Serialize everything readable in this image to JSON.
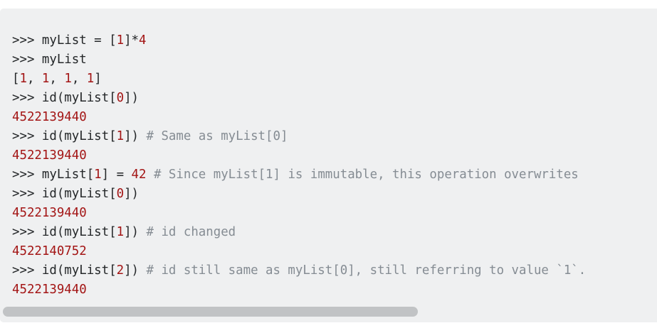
{
  "code": {
    "lines": [
      [
        {
          "t": ">>> myList = ["
        },
        {
          "t": "1",
          "c": "num"
        },
        {
          "t": "]*"
        },
        {
          "t": "4",
          "c": "num"
        }
      ],
      [
        {
          "t": ">>> myList"
        }
      ],
      [
        {
          "t": "["
        },
        {
          "t": "1",
          "c": "num"
        },
        {
          "t": ", "
        },
        {
          "t": "1",
          "c": "num"
        },
        {
          "t": ", "
        },
        {
          "t": "1",
          "c": "num"
        },
        {
          "t": ", "
        },
        {
          "t": "1",
          "c": "num"
        },
        {
          "t": "]"
        }
      ],
      [
        {
          "t": ">>> id(myList["
        },
        {
          "t": "0",
          "c": "num"
        },
        {
          "t": "])"
        }
      ],
      [
        {
          "t": "4522139440",
          "c": "out"
        }
      ],
      [
        {
          "t": ">>> id(myList["
        },
        {
          "t": "1",
          "c": "num"
        },
        {
          "t": "]) "
        },
        {
          "t": "# Same as myList[0]",
          "c": "cmt"
        }
      ],
      [
        {
          "t": "4522139440",
          "c": "out"
        }
      ],
      [
        {
          "t": ">>> myList["
        },
        {
          "t": "1",
          "c": "num"
        },
        {
          "t": "] = "
        },
        {
          "t": "42",
          "c": "num"
        },
        {
          "t": " "
        },
        {
          "t": "# Since myList[1] is immutable, this operation overwrites",
          "c": "cmt"
        }
      ],
      [
        {
          "t": ">>> id(myList["
        },
        {
          "t": "0",
          "c": "num"
        },
        {
          "t": "])"
        }
      ],
      [
        {
          "t": "4522139440",
          "c": "out"
        }
      ],
      [
        {
          "t": ">>> id(myList["
        },
        {
          "t": "1",
          "c": "num"
        },
        {
          "t": "]) "
        },
        {
          "t": "# id changed",
          "c": "cmt"
        }
      ],
      [
        {
          "t": "4522140752",
          "c": "out"
        }
      ],
      [
        {
          "t": ">>> id(myList["
        },
        {
          "t": "2",
          "c": "num"
        },
        {
          "t": "]) "
        },
        {
          "t": "# id still same as myList[0], still referring to value `1`.",
          "c": "cmt"
        }
      ],
      [
        {
          "t": "4522139440",
          "c": "out"
        }
      ]
    ]
  },
  "colors": {
    "background": "#eff0f1",
    "text": "#242729",
    "number": "#a31515",
    "comment": "#858c93",
    "scrollbar_thumb": "#c1c3c5"
  }
}
